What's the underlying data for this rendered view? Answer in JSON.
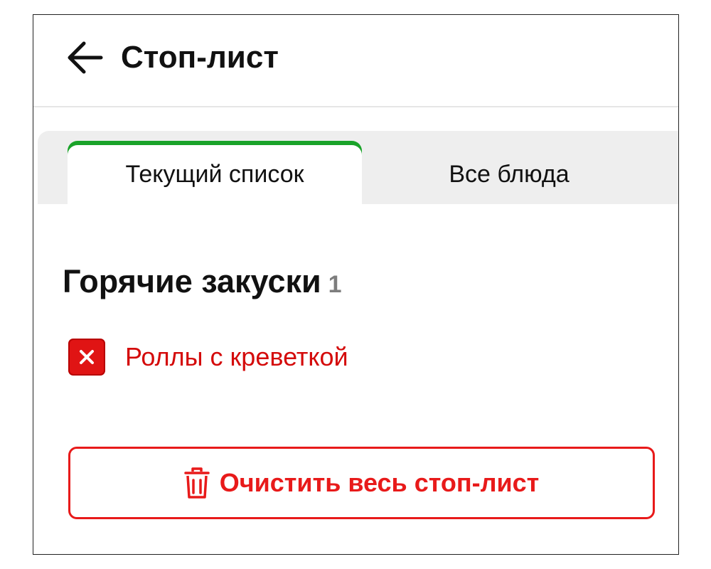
{
  "header": {
    "title": "Стоп-лист",
    "back_icon": "arrow-left-icon"
  },
  "tabs": [
    {
      "label": "Текущий список",
      "active": true
    },
    {
      "label": "Все блюда",
      "active": false
    }
  ],
  "section": {
    "title": "Горячие закуски",
    "count": "1"
  },
  "stop_items": [
    {
      "name": "Роллы с креветкой",
      "icon": "close-icon"
    }
  ],
  "clear_button": {
    "label": "Очистить весь стоп-лист",
    "icon": "trash-icon"
  },
  "colors": {
    "accent_green": "#1aa329",
    "danger_red": "#e01414",
    "text_red": "#d40a0a"
  }
}
